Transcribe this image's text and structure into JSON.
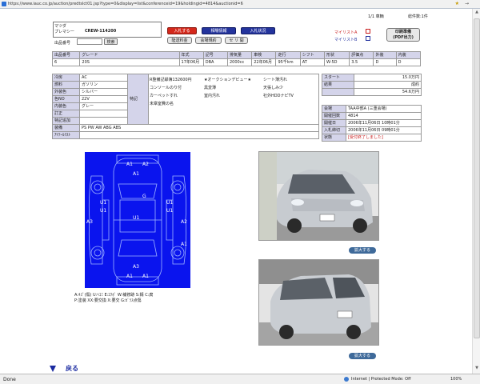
{
  "browser": {
    "url": "https://www.iauc.co.jp/auction/predtslct01.jsp?type=0&display=list&conferenceid=19&holdingid=4814&auctionid=6",
    "status_left": "Done",
    "status_zone": "Internet | Protected Mode: Off",
    "zoom": "100%"
  },
  "header": {
    "paging": "1/1 車輌",
    "total": "総件数:1件",
    "maker": "マツダ",
    "model_label": "プレマシー",
    "model_code": "CREW-114200",
    "lot_label": "出品番号",
    "search_button": "検索",
    "bid_button": "入札する",
    "market_button": "相場情報",
    "bid_status_button": "入札状況",
    "shipping_button": "陸送料金",
    "fee_button": "会場規約",
    "seri_button": "セ リ 開",
    "mylist_a": "マイリストA",
    "mylist_b": "マイリストB",
    "print_button_1": "印刷準備",
    "print_button_2": "(PDF出力)"
  },
  "spec_table": {
    "headers": [
      "出品番号",
      "グレード",
      "年式",
      "記号",
      "排気量",
      "車検",
      "走行",
      "シフト",
      "形状",
      "評価点",
      "外装",
      "内装"
    ],
    "values": [
      "6",
      "20S",
      "17年06月",
      "DBA",
      "2000cc",
      "22年06月",
      "95千km",
      "AT",
      "W-5D",
      "3.5",
      "D",
      "D"
    ]
  },
  "detail_table": {
    "rows": [
      {
        "label": "冷房",
        "value": "AC"
      },
      {
        "label": "燃料",
        "value": "ガソリン"
      },
      {
        "label": "外装色",
        "value": "シルバー"
      },
      {
        "label": "色NO",
        "value": "22V"
      },
      {
        "label": "内装色",
        "value": "グレー"
      },
      {
        "label": "訂正",
        "value": ""
      },
      {
        "label": "特記追加",
        "value": ""
      },
      {
        "label": "装備",
        "value": "PS PW AW ABG ABS"
      },
      {
        "label": "ｱｲﾃｰﾙﾘｽﾄ",
        "value": ""
      }
    ],
    "special_label": "特記",
    "notes_col1": [
      "R整備記録簿132600円",
      "コンソールのり付",
      "カーペットすれ",
      "未章室費の名"
    ],
    "notes_col2": [
      "★オークションデビュー★",
      "黒変薄",
      "室内汚れ"
    ],
    "notes_col3": [
      "シート薄汚れ",
      "天張しみ少",
      "社外HDDナビTV"
    ]
  },
  "price_table": {
    "rows": [
      {
        "label": "スタート",
        "value": "15.0万円"
      },
      {
        "label": "結果",
        "value": "成約"
      },
      {
        "label": "",
        "value": "54.6万円"
      }
    ]
  },
  "venue_table": {
    "rows": [
      {
        "label": "会場",
        "value": "TAA中部A (三重会場)"
      },
      {
        "label": "開催回数",
        "value": "4814"
      },
      {
        "label": "開催日",
        "value": "2006年11月06日 10時01分"
      },
      {
        "label": "入札締切",
        "value": "2006年11月06日 09時01分"
      },
      {
        "label": "状態",
        "value": "[受付終了しました]"
      }
    ]
  },
  "damage_map": {
    "marks": [
      "A1",
      "A2",
      "A1",
      "U1",
      "U1",
      "U1",
      "G",
      "U1",
      "U1",
      "A3",
      "A2",
      "A1",
      "A1",
      "A1",
      "A3"
    ],
    "legend_line1": "A:ｷｽﾞ(傷)   U:ﾍｺﾐ   E:ｴｸﾎﾞ   W:補修跡   S:錆   C:腐",
    "legend_line2": "P:塗装   XX:要交換   X:要交   G:ｶﾞﾗｽ点傷"
  },
  "photos": {
    "zoom_label_1": "拡大する",
    "zoom_label_2": "拡大する"
  },
  "footer": {
    "back_label": "戻る"
  },
  "colors": {
    "damage_bg": "#0a14ee",
    "button_red": "#d4281b",
    "button_blue": "#24349d",
    "header_cell": "#d4d4ea"
  }
}
